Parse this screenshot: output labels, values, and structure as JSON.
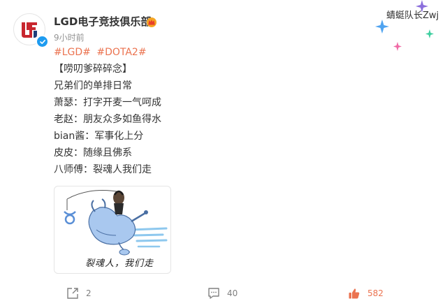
{
  "post": {
    "author": "LGD电子竞技俱乐部",
    "timestamp": "9小时前",
    "badge_text": "蜻蜓队长Zwj",
    "topics": [
      "#LGD#",
      "#DOTA2#"
    ],
    "lines": [
      "【唠叨爹碎碎念】",
      "兄弟们的单排日常",
      "萧瑟：打字开麦一气呵成",
      "老赵：朋友众多如鱼得水",
      "bian酱：军事化上分",
      "皮皮：随缘且佛系",
      "八师傅：裂魂人我们走"
    ],
    "image_caption": "裂魂人，我们走"
  },
  "actions": {
    "share_count": "2",
    "comment_count": "40",
    "like_count": "582"
  },
  "colors": {
    "topic": "#eb7350",
    "like": "#eb7350",
    "muted": "#939393",
    "verify": "#1d9bf0"
  },
  "icons": {
    "share": "share-icon",
    "comment": "comment-icon",
    "like": "thumbs-up-icon",
    "crown": "crown-icon",
    "verify": "verified-check-icon"
  }
}
